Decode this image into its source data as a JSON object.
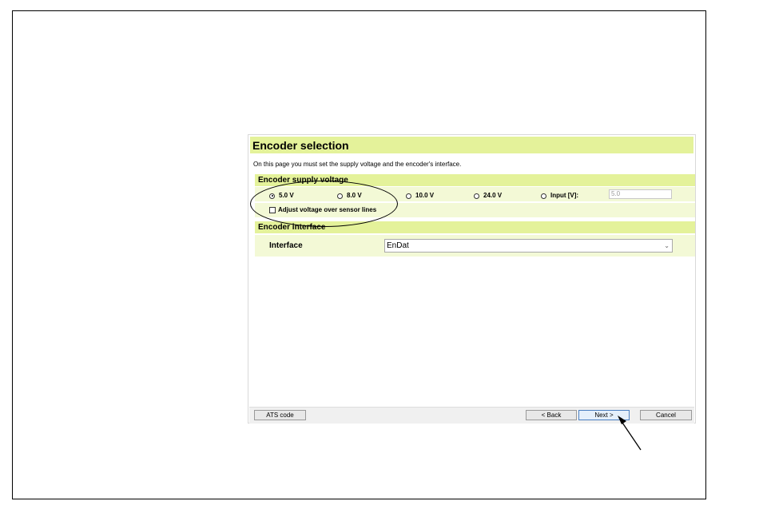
{
  "dialog": {
    "title": "Encoder selection",
    "description": "On this page you must set the supply voltage and the encoder's interface."
  },
  "supply": {
    "heading": "Encoder supply voltage",
    "options": [
      {
        "label": "5.0 V",
        "selected": true
      },
      {
        "label": "8.0 V",
        "selected": false
      },
      {
        "label": "10.0 V",
        "selected": false
      },
      {
        "label": "24.0 V",
        "selected": false
      },
      {
        "label": "Input [V]:",
        "selected": false
      }
    ],
    "input_value": "5.0",
    "adjust_label": "Adjust voltage over sensor lines",
    "adjust_checked": false
  },
  "interface": {
    "heading": "Encoder interface",
    "label": "Interface",
    "selected": "EnDat",
    "chevron_icon": "chevron-down-icon"
  },
  "footer": {
    "ats_label": "ATS code",
    "back_label": "< Back",
    "next_label": "Next >",
    "cancel_label": "Cancel"
  },
  "colors": {
    "section_bg": "#e4f29a",
    "row_bg": "#f3f9d6",
    "primary_border": "#4a7fc1"
  }
}
